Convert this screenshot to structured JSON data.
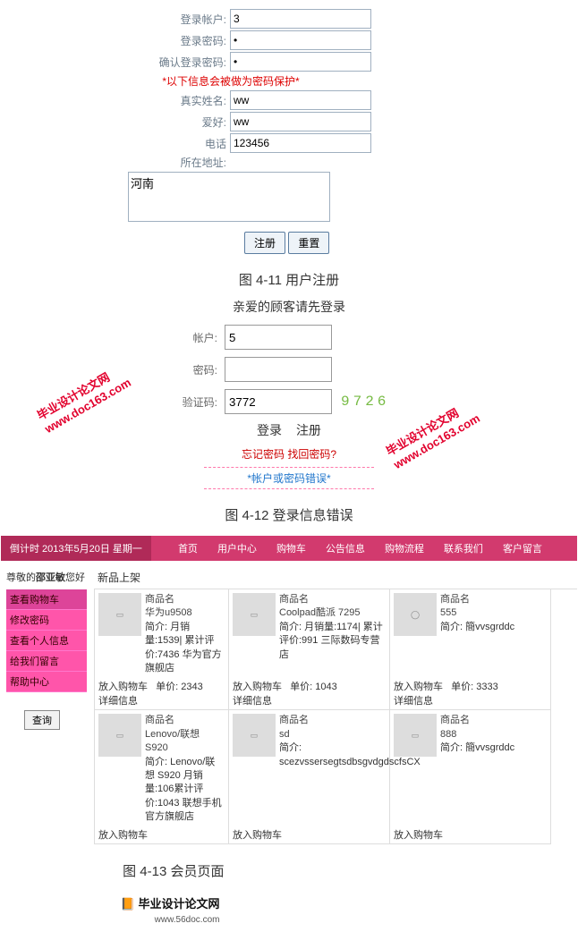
{
  "reg": {
    "labels": {
      "account": "登录帐户:",
      "pwd": "登录密码:",
      "pwd2": "确认登录密码:",
      "name": "真实姓名:",
      "hobby": "爱好:",
      "phone": "电话",
      "addr": "所在地址:"
    },
    "note": "*以下信息会被做为密码保护*",
    "values": {
      "account": "3",
      "pwd": "•",
      "pwd2": "•",
      "name": "ww",
      "hobby": "ww",
      "phone": "123456",
      "addr": "河南"
    },
    "btn_submit": "注册",
    "btn_reset": "重置"
  },
  "cap1": "图 4-11  用户注册",
  "login": {
    "title": "亲爱的顾客请先登录",
    "labels": {
      "account": "帐户:",
      "pwd": "密码:",
      "captcha": "验证码:"
    },
    "values": {
      "account": "5",
      "pwd": "",
      "captcha_input": "3772",
      "captcha_img": "9726"
    },
    "login_btn": "登录",
    "reg_btn": "注册",
    "forgot": "忘记密码 找回密码?",
    "error": "*帐户或密码错误*"
  },
  "cap2": "图 4-12  登录信息错误",
  "watermark": {
    "line1": "毕业设计论文网",
    "line2": "www.doc163.com"
  },
  "shop": {
    "nav_left": "倒计时 2013年5月20日 星期一",
    "nav_items": [
      "首页",
      "用户中心",
      "购物车",
      "公告信息",
      "购物流程",
      "联系我们",
      "客户留言"
    ],
    "hello_prefix": "尊敬的",
    "hello_name": "邵亚敏",
    "hello_suffix": "您好",
    "side": [
      "查看购物车",
      "修改密码",
      "查看个人信息",
      "给我们留言",
      "帮助中心"
    ],
    "query": "查询",
    "section": "新品上架",
    "name_label": "商品名",
    "addcart": "放入购物车",
    "detail": "详细信息",
    "products_row1": [
      {
        "name": "华为u9508",
        "desc": "简介: 月销量:1539| 累计评价:7436 华为官方旗舰店",
        "price": "单价: 2343"
      },
      {
        "name": "Coolpad酷派  7295",
        "desc": "简介: 月销量:1174| 累计评价:991 三际数码专营店",
        "price": "单价: 1043"
      },
      {
        "name": "555",
        "desc": "简介: 簡vvsgrddc",
        "price": "单价: 3333"
      }
    ],
    "products_row2": [
      {
        "name": "Lenovo/联想 S920",
        "desc": "简介: Lenovo/联想 S920 月销量:106累计评价:1043 联想手机官方旗舰店",
        "price": ""
      },
      {
        "name": "sd",
        "desc": "简介: scezvssersegtsdbsgvdgdscfsCX",
        "price": ""
      },
      {
        "name": "888",
        "desc": "简介: 簡vvsgrddc",
        "price": ""
      }
    ]
  },
  "cap3": "图 4-13 会员页面",
  "footer": {
    "brand": "毕业设计论文网",
    "url": "www.56doc.com"
  }
}
